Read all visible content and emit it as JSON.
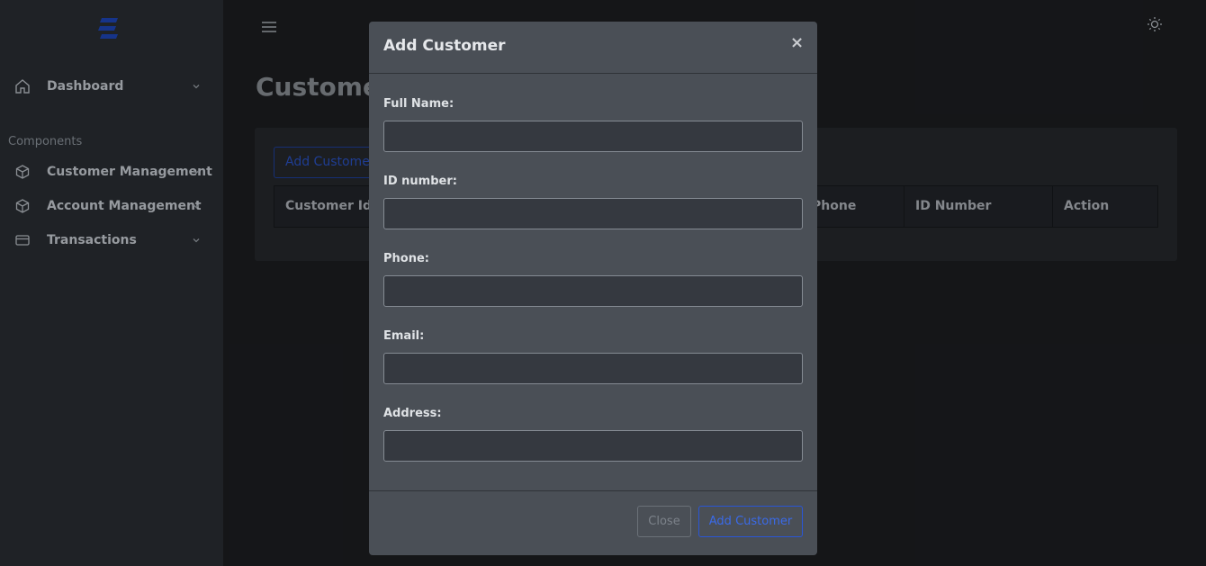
{
  "sidebar": {
    "items": [
      {
        "label": "Dashboard",
        "icon": "home-icon"
      },
      {
        "label": "Customer Management",
        "icon": "box-icon"
      },
      {
        "label": "Account Management",
        "icon": "box-icon"
      },
      {
        "label": "Transactions",
        "icon": "credit-card-icon"
      }
    ],
    "section_label": "Components"
  },
  "main": {
    "page_title": "Customer",
    "add_button_label": "Add Customer",
    "table_headers": [
      "Customer Id",
      "Phone",
      "ID Number",
      "Action"
    ]
  },
  "modal": {
    "title": "Add Customer",
    "close_symbol": "×",
    "fields": [
      {
        "label": "Full Name:",
        "value": ""
      },
      {
        "label": "ID number:",
        "value": ""
      },
      {
        "label": "Phone:",
        "value": ""
      },
      {
        "label": "Email:",
        "value": ""
      },
      {
        "label": "Address:",
        "value": ""
      }
    ],
    "close_button_label": "Close",
    "submit_button_label": "Add Customer"
  },
  "colors": {
    "accent": "#2a56d6",
    "sidebar_bg": "#2a2e33",
    "modal_bg": "#4a4f56"
  }
}
